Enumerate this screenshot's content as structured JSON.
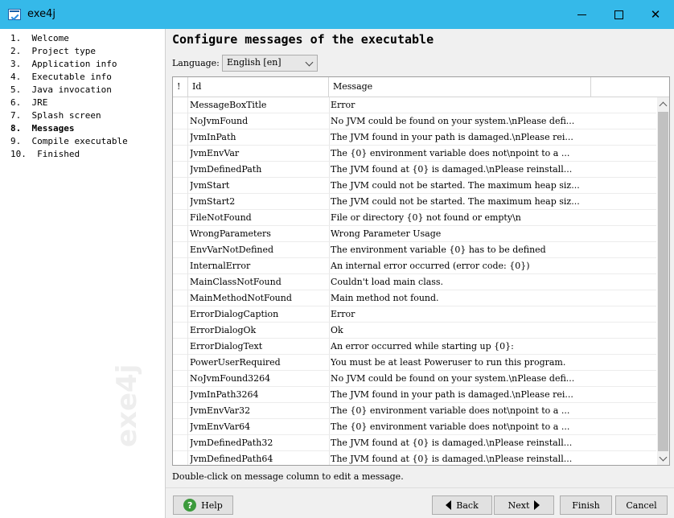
{
  "window": {
    "title": "exe4j",
    "icon": "app-icon"
  },
  "sidebar": {
    "watermark": "exe4j",
    "steps": [
      {
        "label": "1.  Welcome",
        "active": false
      },
      {
        "label": "2.  Project type",
        "active": false
      },
      {
        "label": "3.  Application info",
        "active": false
      },
      {
        "label": "4.  Executable info",
        "active": false
      },
      {
        "label": "5.  Java invocation",
        "active": false
      },
      {
        "label": "6.  JRE",
        "active": false
      },
      {
        "label": "7.  Splash screen",
        "active": false
      },
      {
        "label": "8.  Messages",
        "active": true
      },
      {
        "label": "9.  Compile executable",
        "active": false
      },
      {
        "label": "10.  Finished",
        "active": false
      }
    ]
  },
  "main": {
    "heading": "Configure messages of the executable",
    "language_label": "Language:",
    "language_value": "English [en]",
    "hint": "Double-click on message column to edit a message."
  },
  "table": {
    "headers": {
      "bang": "!",
      "id": "Id",
      "message": "Message"
    },
    "rows": [
      {
        "id": "MessageBoxTitle",
        "message": "Error"
      },
      {
        "id": "NoJvmFound",
        "message": "No JVM could be found on your system.\\nPlease defi..."
      },
      {
        "id": "JvmInPath",
        "message": "The JVM found in your path is damaged.\\nPlease rei..."
      },
      {
        "id": "JvmEnvVar",
        "message": "The {0} environment variable does not\\npoint to a ..."
      },
      {
        "id": "JvmDefinedPath",
        "message": "The JVM found at {0} is damaged.\\nPlease reinstall..."
      },
      {
        "id": "JvmStart",
        "message": "The JVM could not be started. The maximum heap siz..."
      },
      {
        "id": "JvmStart2",
        "message": "The JVM could not be started. The maximum heap siz..."
      },
      {
        "id": "FileNotFound",
        "message": "File or directory {0} not found or empty\\n"
      },
      {
        "id": "WrongParameters",
        "message": "Wrong Parameter Usage"
      },
      {
        "id": "EnvVarNotDefined",
        "message": "The environment variable {0} has to be defined"
      },
      {
        "id": "InternalError",
        "message": "An internal error occurred (error code: {0})"
      },
      {
        "id": "MainClassNotFound",
        "message": "Couldn't load main class."
      },
      {
        "id": "MainMethodNotFound",
        "message": "Main method not found."
      },
      {
        "id": "ErrorDialogCaption",
        "message": "Error"
      },
      {
        "id": "ErrorDialogOk",
        "message": "Ok"
      },
      {
        "id": "ErrorDialogText",
        "message": "An error occurred while starting up {0}:"
      },
      {
        "id": "PowerUserRequired",
        "message": "You must be at least Poweruser to run this program."
      },
      {
        "id": "NoJvmFound3264",
        "message": "No JVM could be found on your system.\\nPlease defi..."
      },
      {
        "id": "JvmInPath3264",
        "message": "The JVM found in your path is damaged.\\nPlease rei..."
      },
      {
        "id": "JvmEnvVar32",
        "message": "The {0} environment variable does not\\npoint to a ..."
      },
      {
        "id": "JvmEnvVar64",
        "message": "The {0} environment variable does not\\npoint to a ..."
      },
      {
        "id": "JvmDefinedPath32",
        "message": "The JVM found at {0} is damaged.\\nPlease reinstall..."
      },
      {
        "id": "JvmDefinedPath64",
        "message": "The JVM found at {0} is damaged.\\nPlease reinstall..."
      }
    ]
  },
  "buttons": {
    "help": "Help",
    "back": "Back",
    "next": "Next",
    "finish": "Finish",
    "cancel": "Cancel"
  }
}
